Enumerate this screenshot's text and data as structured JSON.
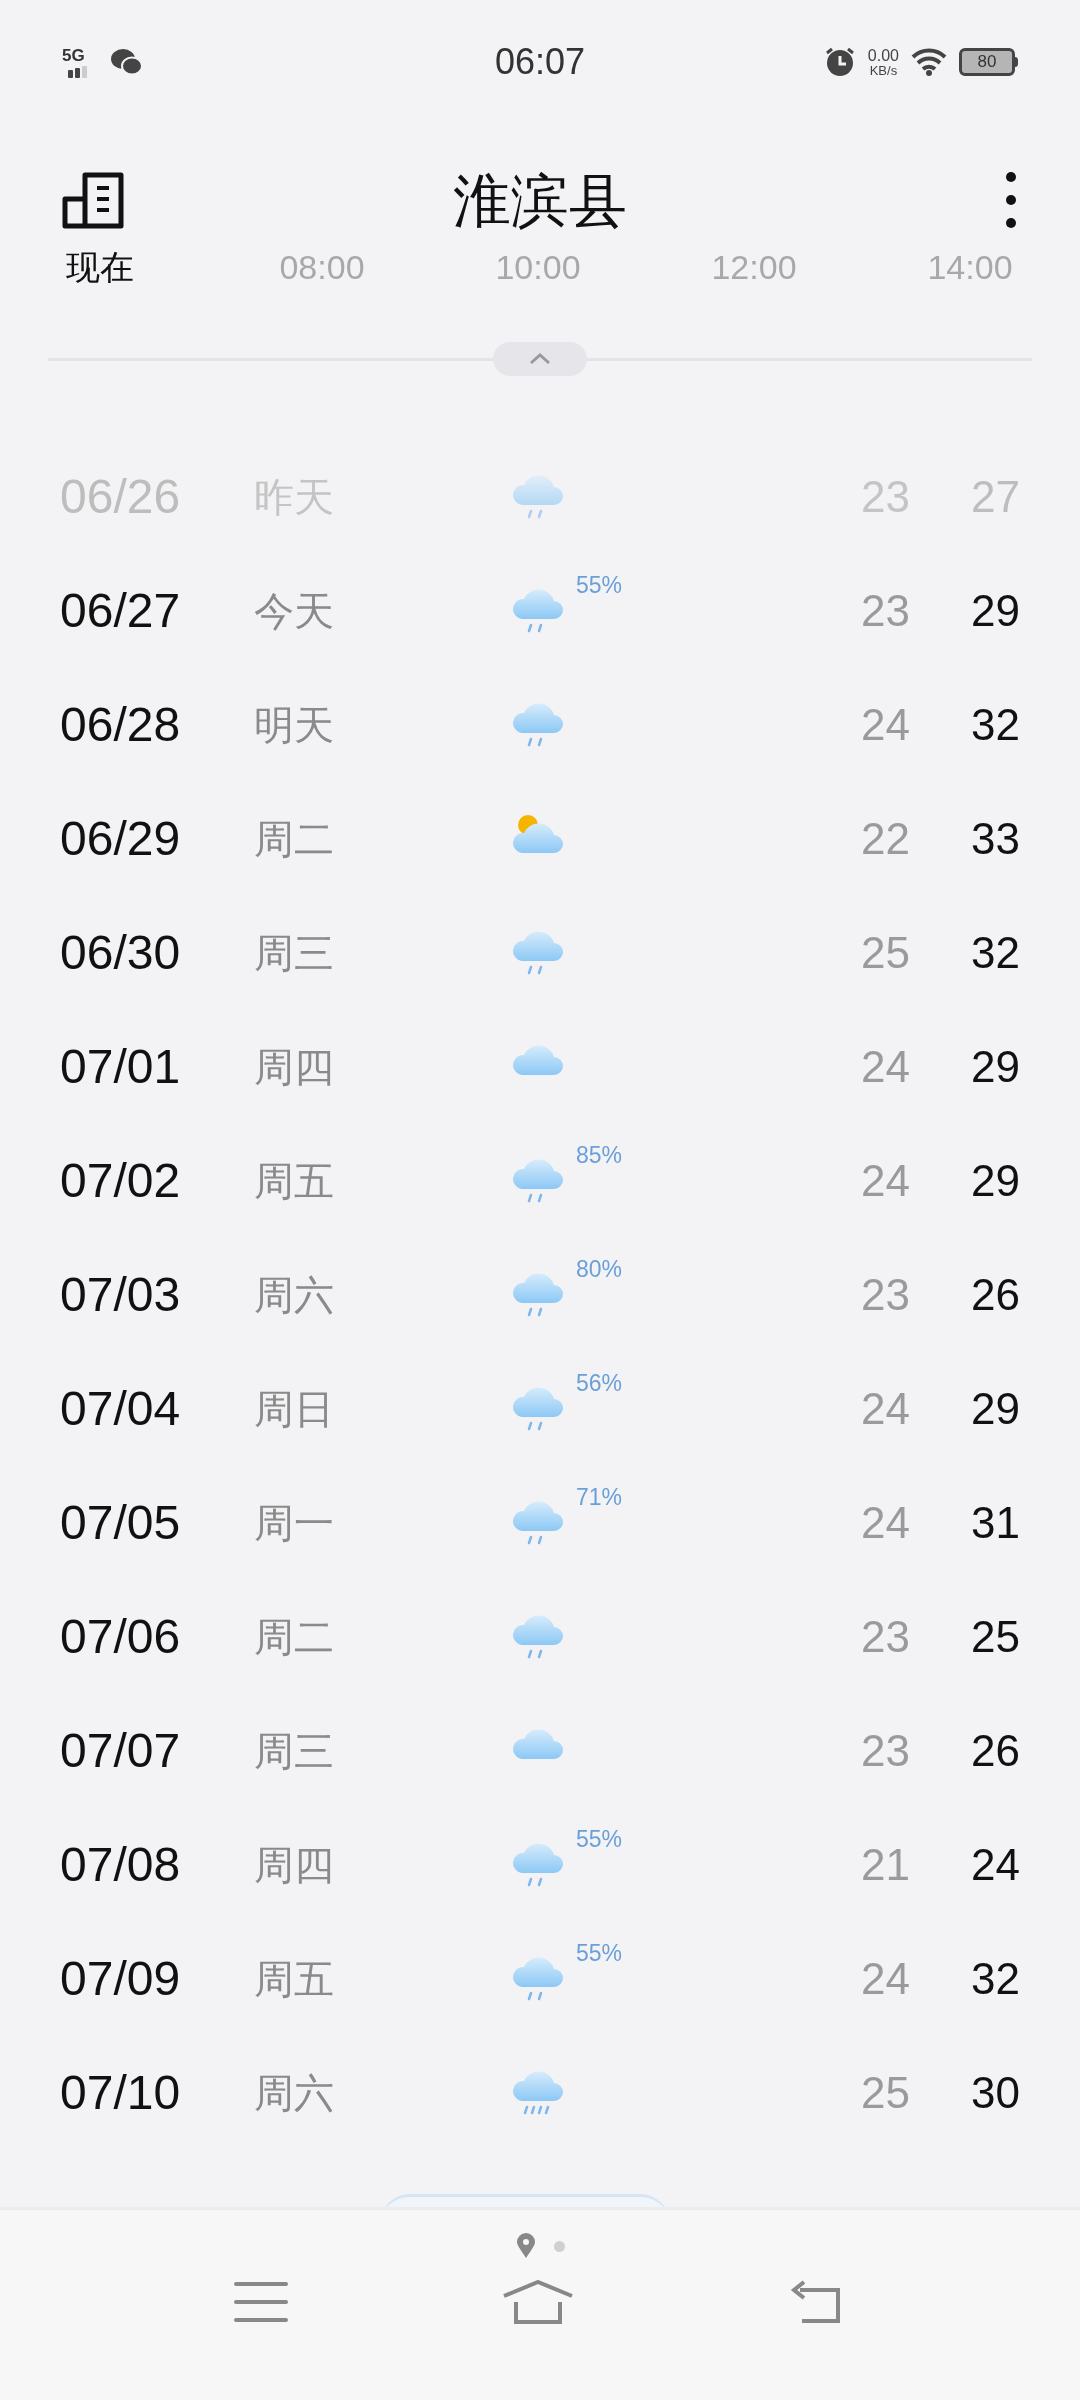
{
  "status_bar": {
    "network": "5G",
    "time": "06:07",
    "speed_value": "0.00",
    "speed_unit": "KB/s",
    "battery": "80"
  },
  "header": {
    "title": "淮滨县",
    "now_label": "现在",
    "hours": [
      "08:00",
      "10:00",
      "12:00",
      "14:00"
    ]
  },
  "days": [
    {
      "date": "06/26",
      "weekday": "昨天",
      "kind": "rain",
      "past": true,
      "low": "23",
      "high": "27"
    },
    {
      "date": "06/27",
      "weekday": "今天",
      "kind": "rain",
      "past": false,
      "pop": "55%",
      "low": "23",
      "high": "29"
    },
    {
      "date": "06/28",
      "weekday": "明天",
      "kind": "rain",
      "past": false,
      "low": "24",
      "high": "32"
    },
    {
      "date": "06/29",
      "weekday": "周二",
      "kind": "sun_cloud",
      "past": false,
      "low": "22",
      "high": "33"
    },
    {
      "date": "06/30",
      "weekday": "周三",
      "kind": "rain",
      "past": false,
      "low": "25",
      "high": "32"
    },
    {
      "date": "07/01",
      "weekday": "周四",
      "kind": "cloud",
      "past": false,
      "low": "24",
      "high": "29"
    },
    {
      "date": "07/02",
      "weekday": "周五",
      "kind": "rain",
      "past": false,
      "pop": "85%",
      "low": "24",
      "high": "29"
    },
    {
      "date": "07/03",
      "weekday": "周六",
      "kind": "rain",
      "past": false,
      "pop": "80%",
      "low": "23",
      "high": "26"
    },
    {
      "date": "07/04",
      "weekday": "周日",
      "kind": "rain",
      "past": false,
      "pop": "56%",
      "low": "24",
      "high": "29"
    },
    {
      "date": "07/05",
      "weekday": "周一",
      "kind": "rain",
      "past": false,
      "pop": "71%",
      "low": "24",
      "high": "31"
    },
    {
      "date": "07/06",
      "weekday": "周二",
      "kind": "rain",
      "past": false,
      "low": "23",
      "high": "25"
    },
    {
      "date": "07/07",
      "weekday": "周三",
      "kind": "cloud",
      "past": false,
      "low": "23",
      "high": "26"
    },
    {
      "date": "07/08",
      "weekday": "周四",
      "kind": "rain",
      "past": false,
      "pop": "55%",
      "low": "21",
      "high": "24"
    },
    {
      "date": "07/09",
      "weekday": "周五",
      "kind": "rain",
      "past": false,
      "pop": "55%",
      "low": "24",
      "high": "32"
    },
    {
      "date": "07/10",
      "weekday": "周六",
      "kind": "heavy_rain",
      "past": false,
      "low": "25",
      "high": "30"
    }
  ]
}
